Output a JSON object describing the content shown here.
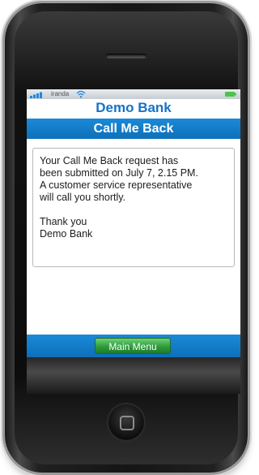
{
  "status_bar": {
    "carrier": "iranda"
  },
  "app": {
    "name": "Demo Bank"
  },
  "screen": {
    "title": "Call Me Back",
    "message_lines": [
      "Your Call Me Back request has",
      "been submitted on July 7, 2.15 PM.",
      "A customer service representative",
      "will call you shortly."
    ],
    "signoff_lines": [
      "Thank you",
      "Demo Bank"
    ]
  },
  "footer": {
    "main_menu_label": "Main Menu"
  },
  "colors": {
    "accent_blue": "#1b8ad8",
    "brand_text": "#1772c5",
    "button_green": "#2d9c3a"
  },
  "icons": [
    "signal-icon",
    "wifi-icon",
    "battery-icon",
    "home-button-icon"
  ]
}
